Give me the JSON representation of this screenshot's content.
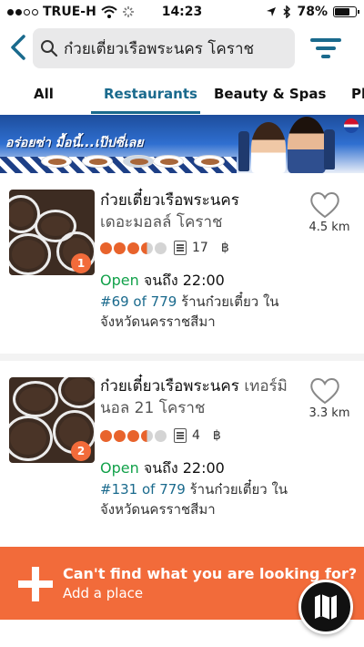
{
  "status_bar": {
    "carrier": "TRUE-H",
    "time": "14:23",
    "battery": "78%",
    "battery_level": 0.78,
    "signal_bars": 2,
    "icons": [
      "wifi-icon",
      "activity-spinner-icon",
      "location-arrow-icon",
      "bluetooth-icon",
      "battery-icon"
    ]
  },
  "search": {
    "query": "ก๋วยเตี๋ยวเรือพระนคร โคราช",
    "icons": [
      "back-chevron-icon",
      "search-icon",
      "filter-icon"
    ]
  },
  "tabs": [
    {
      "label": "All",
      "active": false
    },
    {
      "label": "Restaurants",
      "active": true
    },
    {
      "label": "Beauty & Spas",
      "active": false
    },
    {
      "label": "Pl",
      "active": false
    }
  ],
  "banner": {
    "slogan": "อร่อยซ่า มื้อนี้...เป๊ปซี่เลย",
    "brand": "pepsi-logo"
  },
  "listings": [
    {
      "name": "ก๋วยเตี๋ยวเรือพระนคร",
      "location": "เดอะมอลล์ โคราช",
      "rating": 3.5,
      "reviews": "17",
      "price": "฿",
      "rank_badge": "1",
      "distance": "4.5 km",
      "open_label": "Open",
      "hours": "จนถึง 22:00",
      "rank_text": "#69 of 779",
      "category_text": "ร้านก๋วยเตี๋ยว ใน จังหวัดนครราชสีมา"
    },
    {
      "name": "ก๋วยเตี๋ยวเรือพระนคร",
      "location": "เทอร์มินอล 21 โคราช",
      "rating": 3.5,
      "reviews": "4",
      "price": "฿",
      "rank_badge": "2",
      "distance": "3.3 km",
      "open_label": "Open",
      "hours": "จนถึง 22:00",
      "rank_text": "#131 of 779",
      "category_text": "ร้านก๋วยเตี๋ยว ใน จังหวัดนครราชสีมา"
    }
  ],
  "add_place": {
    "question": "Can't find what you are looking for?",
    "action": "Add a place"
  },
  "colors": {
    "accent": "#1a6a8d",
    "orange": "#f26b3a",
    "open_green": "#12a14a",
    "rating_bubble": "#e8632c"
  }
}
